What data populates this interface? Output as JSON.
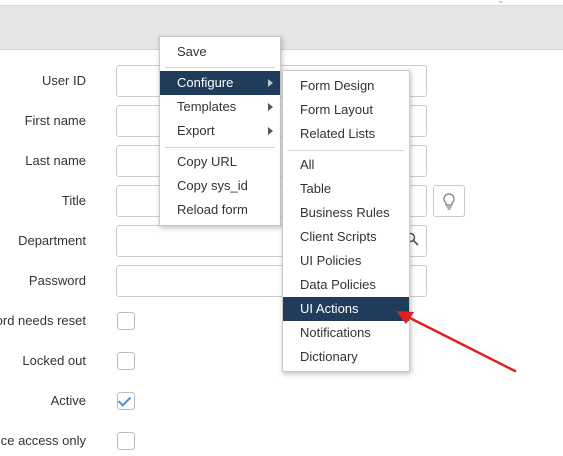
{
  "form": {
    "labels": {
      "user_id": "User ID",
      "first_name": "First name",
      "last_name": "Last name",
      "title": "Title",
      "department": "Department",
      "password": "Password",
      "password_needs_reset": "ord needs reset",
      "locked_out": "Locked out",
      "active": "Active",
      "web_service_access_only": "ce access only"
    },
    "active_checked": true
  },
  "context_menu": {
    "save": "Save",
    "configure": "Configure",
    "templates": "Templates",
    "export": "Export",
    "copy_url": "Copy URL",
    "copy_sys_id": "Copy sys_id",
    "reload_form": "Reload form"
  },
  "configure_submenu": {
    "form_design": "Form Design",
    "form_layout": "Form Layout",
    "related_lists": "Related Lists",
    "all": "All",
    "table": "Table",
    "business_rules": "Business Rules",
    "client_scripts": "Client Scripts",
    "ui_policies": "UI Policies",
    "data_policies": "Data Policies",
    "ui_actions": "UI Actions",
    "notifications": "Notifications",
    "dictionary": "Dictionary"
  },
  "colors": {
    "menu_highlight": "#1f3d5a",
    "annotation_arrow": "#e02020",
    "checkbox_check": "#4a90c9"
  }
}
